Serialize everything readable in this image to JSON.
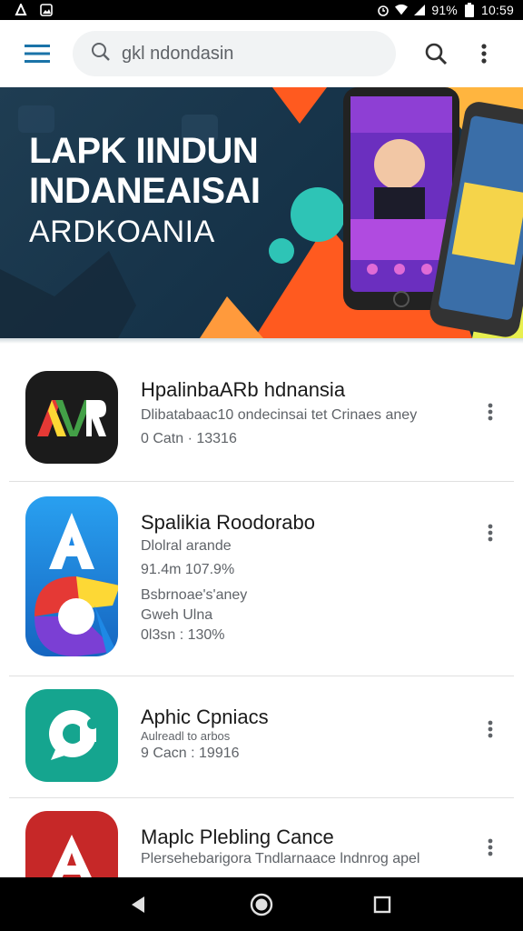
{
  "status_bar": {
    "battery_text": "91%",
    "time": "10:59",
    "icons": [
      "notification-icon",
      "image-icon",
      "alarm-icon",
      "wifi-icon",
      "signal-icon",
      "battery-icon"
    ]
  },
  "app_bar": {
    "search_query": "gkl ndondasin",
    "icons": [
      "hamburger-menu-icon",
      "search-icon",
      "more-vert-icon"
    ]
  },
  "banner": {
    "title": "LAPK IINDUN\nINDANEAISAI",
    "subtitle": "ARDKOANIA",
    "colors": {
      "background": "#1f3d52",
      "accent_orange": "#ff5a1f",
      "accent_teal": "#2ec4b6",
      "phone_purple": "#8e3fd4"
    }
  },
  "apps": [
    {
      "name": "HpalinbaARb hdnansia",
      "lines": [
        "Dlibatabaac10 ondecinsai tet Crinaes aney",
        "0 Catn · 13316"
      ],
      "icon": "avr-logo-icon",
      "icon_color": "#1b1b1b"
    },
    {
      "name": "Spalikia Roodorabo",
      "lines": [
        "Dlolral arande",
        "91.4m 107.9%",
        "Bsbrnoae's'aney",
        "Gweh Ulna",
        "0l3sn : 130%"
      ],
      "icon": "a-letter-logo-icon",
      "icon_color": "#1e88e5"
    },
    {
      "name": "Aphic Cpniacs",
      "lines": [
        "Aulreadl to arbos",
        "9 Cacn : 19916"
      ],
      "icon": "chat-bubble-logo-icon",
      "icon_color": "#15a58f"
    },
    {
      "name": "Maplc Plebling Cance",
      "lines": [
        "Plersehebarigora Tndlarnaace lndnrog apel"
      ],
      "icon": "red-a-logo-icon",
      "icon_color": "#c62828"
    }
  ],
  "nav_bar": {
    "icons": [
      "back-icon",
      "home-icon",
      "recents-icon"
    ]
  }
}
